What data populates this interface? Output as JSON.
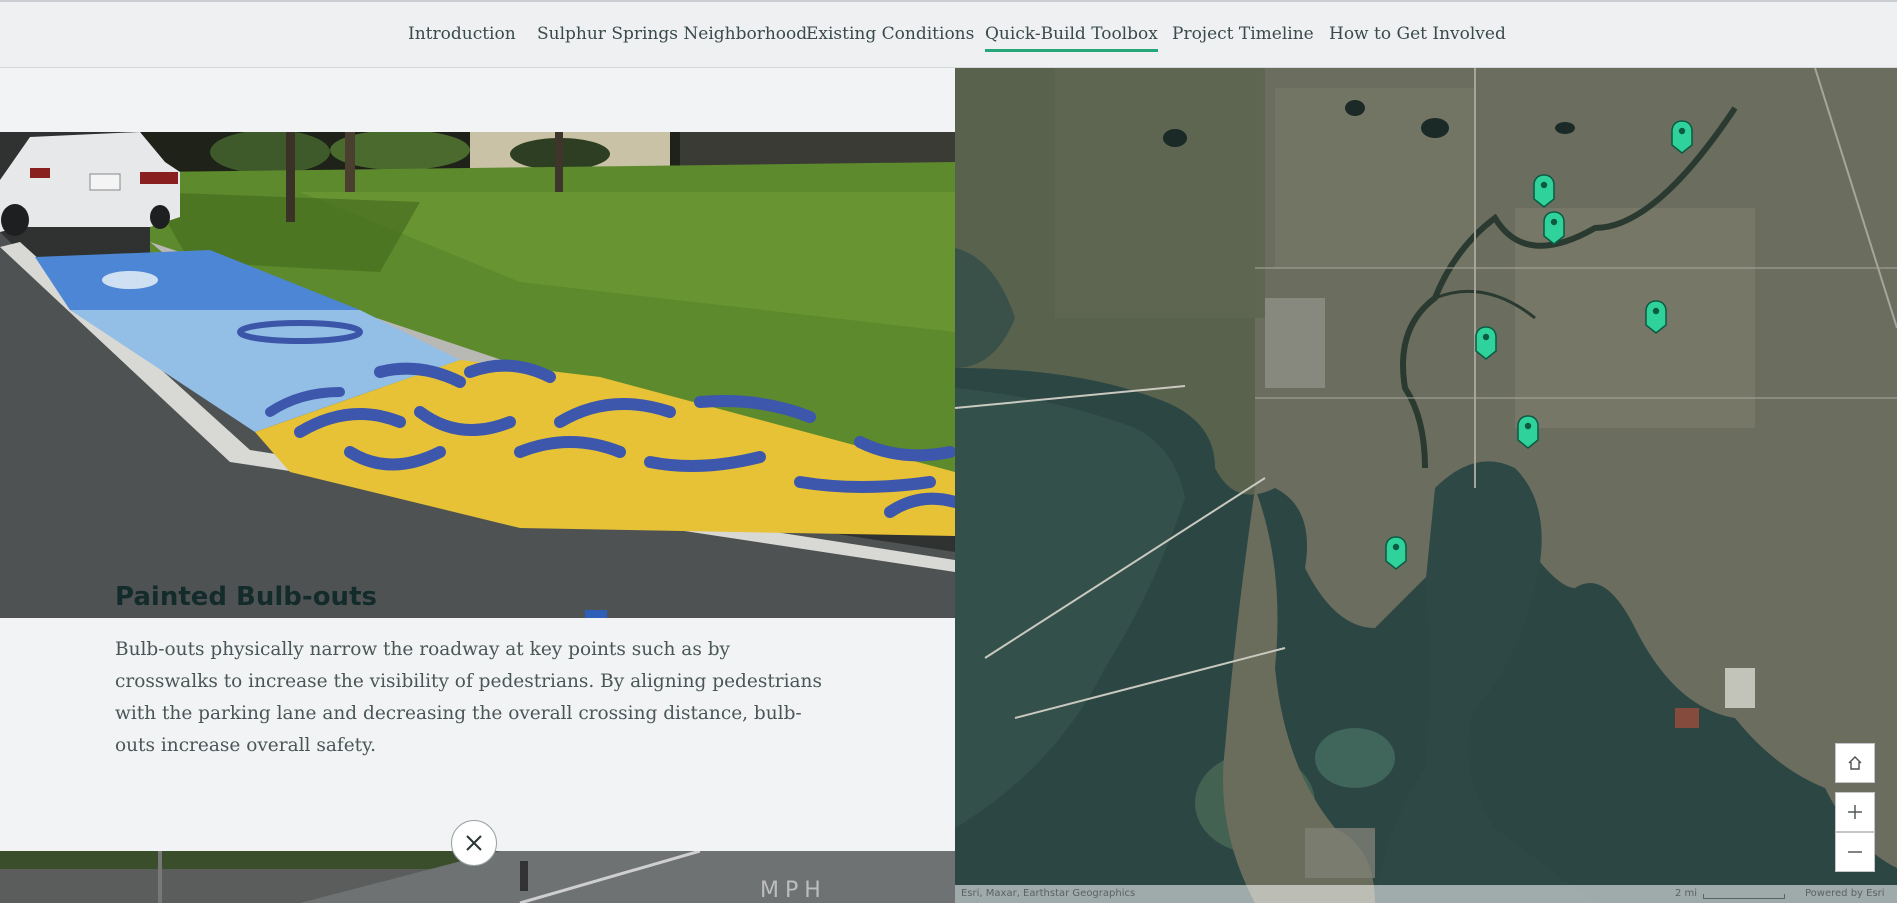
{
  "nav": {
    "items": [
      {
        "label": "Introduction"
      },
      {
        "label": "Sulphur Springs Neighborhood"
      },
      {
        "label": "Existing Conditions"
      },
      {
        "label": "Quick-Build Toolbox",
        "active": true
      },
      {
        "label": "Project Timeline"
      },
      {
        "label": "How to Get Involved"
      }
    ]
  },
  "card": {
    "title": "Painted Bulb-outs",
    "body": "Bulb-outs physically narrow the roadway at key points such as by crosswalks to increase the visibility of pedestrians. By aligning pedestrians with the parking lane and decreasing the overall crossing distance, bulb-outs increase overall safety."
  },
  "photo": {
    "road_marking": "MPH"
  },
  "map": {
    "marker_count": 7,
    "controls": {
      "home": "home-icon",
      "zoom_in": "plus-icon",
      "zoom_out": "minus-icon"
    },
    "attribution": "Esri, Maxar, Earthstar Geographics",
    "scale_label": "2 mi",
    "powered_by": "Powered by Esri"
  },
  "colors": {
    "accent": "#27a67a",
    "marker": "#2fd29a",
    "marker_outline": "#0b5a42"
  },
  "icons": {
    "close": "close-icon"
  }
}
